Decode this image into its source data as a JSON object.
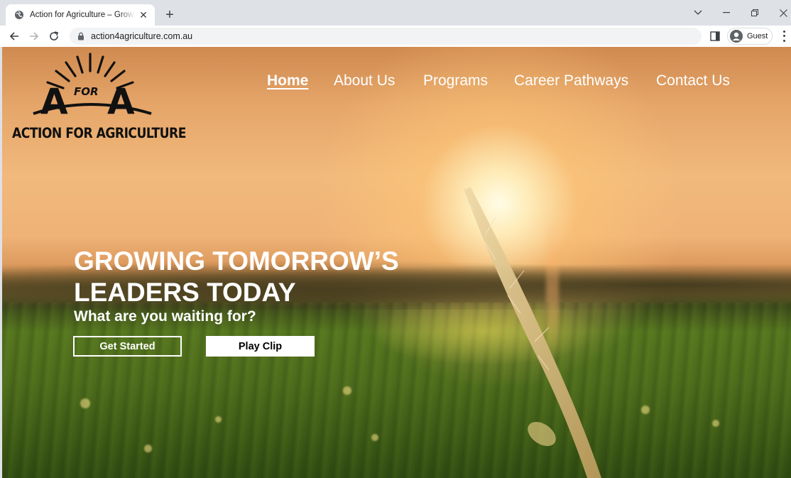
{
  "browser": {
    "tab": {
      "title": "Action for Agriculture – Growing Tomorrow's Leaders Today",
      "favicon": "globe-icon",
      "close_label": "✕"
    },
    "new_tab_label": "+",
    "window_controls": {
      "minimize": "–",
      "restore": "❐",
      "close": "✕",
      "tab_search": "⌄"
    },
    "address_bar": {
      "url": "action4agriculture.com.au",
      "lock_icon": "lock-icon"
    },
    "profile_label": "Guest"
  },
  "site": {
    "logo": {
      "mark_letters": "A",
      "mark_middle": "FOR",
      "caption": "ACTION FOR AGRICULTURE"
    },
    "nav": [
      {
        "label": "Home",
        "active": true
      },
      {
        "label": "About Us",
        "active": false
      },
      {
        "label": "Programs",
        "active": false
      },
      {
        "label": "Career Pathways",
        "active": false
      },
      {
        "label": "Contact Us",
        "active": false
      }
    ],
    "hero": {
      "headline_line1": "GROWING TOMORROW’S",
      "headline_line2": "LEADERS TODAY",
      "subheading": "What are you waiting for?",
      "primary_button": "Get Started",
      "secondary_button": "Play Clip"
    }
  },
  "colors": {
    "chrome_bg": "#dee1e6",
    "toolbar_bg": "#ffffff",
    "omnibox_bg": "#f1f3f4",
    "hero_text": "#ffffff",
    "logo_ink": "#111111"
  }
}
